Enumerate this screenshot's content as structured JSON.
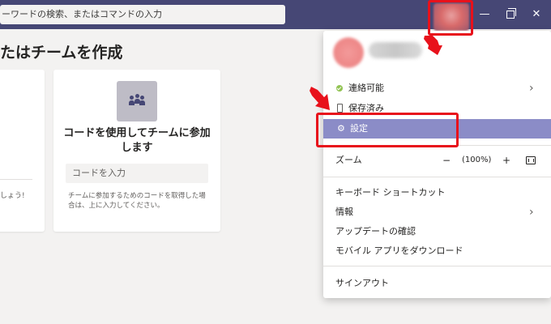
{
  "titlebar": {
    "search_placeholder": "ーワードの検索、またはコマンドの入力",
    "minimize_glyph": "—",
    "close_glyph": "✕",
    "bg_color": "#464775"
  },
  "main": {
    "page_title": "たはチームを作成",
    "left_card": {
      "text_fragment": "しょう!"
    },
    "join_card": {
      "heading": "コードを使用してチームに参加します",
      "input_placeholder": "コードを入力",
      "note": "チームに参加するためのコードを取得した場合は、上に入力してください。"
    }
  },
  "menu": {
    "status": "連絡可能",
    "saved": "保存済み",
    "settings": "設定",
    "zoom": {
      "label": "ズーム",
      "minus": "−",
      "value": "(100%)",
      "plus": "+"
    },
    "shortcuts": "キーボード ショートカット",
    "info": "情報",
    "updates": "アップデートの確認",
    "mobile": "モバイル アプリをダウンロード",
    "signout": "サインアウト",
    "chevron": "›",
    "highlight_color": "#8b8cc7"
  },
  "icons": {
    "gear": "⚙",
    "status_available": "check-circle",
    "saved": "phone",
    "fit_window": "fit-to-window"
  },
  "annotations": {
    "color": "#e8111b"
  }
}
